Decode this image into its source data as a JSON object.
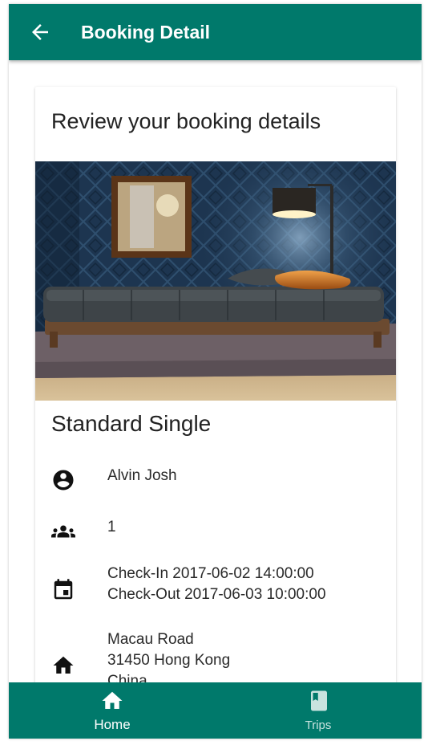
{
  "app_bar": {
    "title": "Booking Detail",
    "back_icon": "arrow-back-icon",
    "background": "#00796b"
  },
  "card": {
    "heading": "Review your booking details",
    "room_name": "Standard Single",
    "photo": "hotel-room-photo",
    "guest_name": "Alvin Josh",
    "guest_count": "1",
    "check_in": "Check-In 2017-06-02 14:00:00",
    "check_out": "Check-Out 2017-06-03 10:00:00",
    "address": {
      "line1": "Macau Road",
      "line2": "31450 Hong Kong",
      "line3": "China"
    },
    "icons": {
      "guest": "account-circle-icon",
      "people": "people-group-icon",
      "dates": "calendar-event-icon",
      "address": "home-icon"
    }
  },
  "bottom_nav": {
    "items": [
      {
        "label": "Home",
        "icon": "home-icon",
        "active": true
      },
      {
        "label": "Trips",
        "icon": "book-icon",
        "active": false
      }
    ]
  }
}
